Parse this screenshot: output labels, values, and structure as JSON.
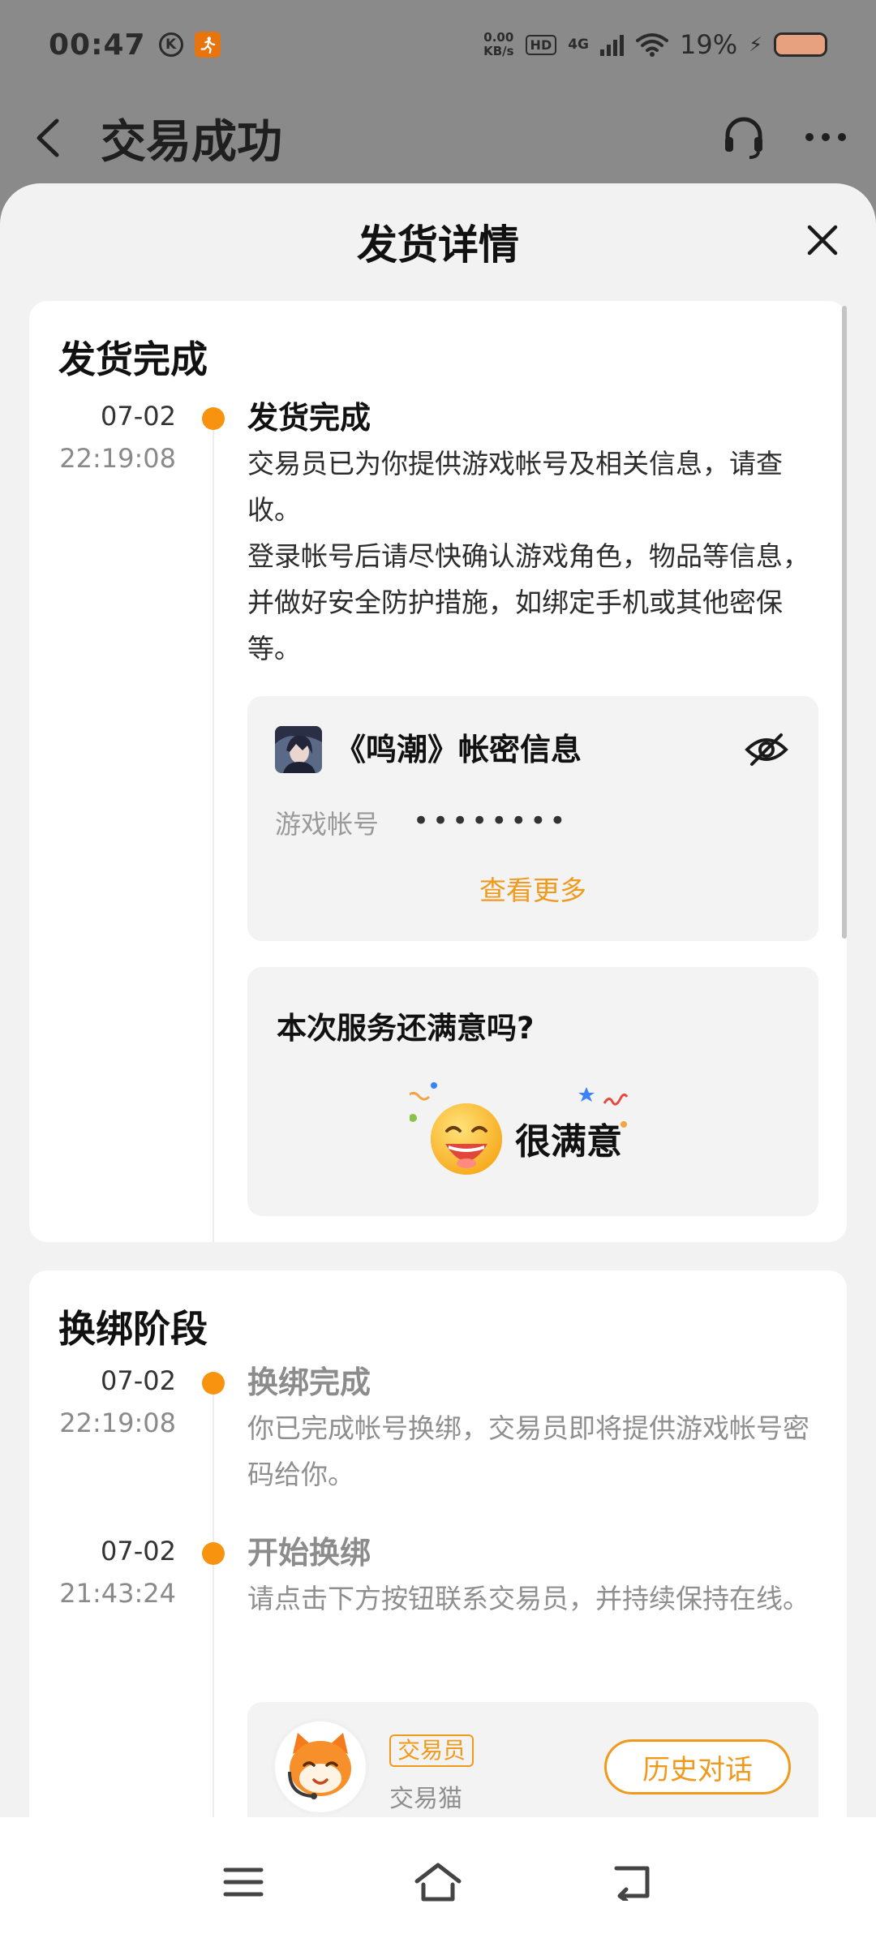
{
  "status_bar": {
    "time": "00:47",
    "k_icon": "K",
    "net_speed_value": "0.00",
    "net_speed_unit": "KB/s",
    "hd": "HD",
    "signal": "4G",
    "battery_percent": "19%",
    "battery_level": 0.19
  },
  "header": {
    "title": "交易成功"
  },
  "sheet": {
    "title": "发货详情"
  },
  "delivery_section": {
    "title": "发货完成",
    "event": {
      "date": "07-02",
      "time": "22:19:08",
      "heading": "发货完成",
      "body": "交易员已为你提供游戏帐号及相关信息，请查收。\n登录帐号后请尽快确认游戏角色，物品等信息，并做好安全防护措施，如绑定手机或其他密保等。"
    },
    "account_card": {
      "title": "《鸣潮》帐密信息",
      "field_label": "游戏帐号",
      "field_value": "••••••••",
      "more_link": "查看更多"
    },
    "rating_card": {
      "question": "本次服务还满意吗?",
      "rating_label": "很满意"
    }
  },
  "rebind_section": {
    "title": "换绑阶段",
    "events": [
      {
        "date": "07-02",
        "time": "22:19:08",
        "heading": "换绑完成",
        "body": "你已完成帐号换绑，交易员即将提供游戏帐号密码给你。"
      },
      {
        "date": "07-02",
        "time": "21:43:24",
        "heading": "开始换绑",
        "body": "请点击下方按钮联系交易员，并持续保持在线。"
      }
    ],
    "agent": {
      "badge": "交易员",
      "name": "交易猫",
      "history_button": "历史对话"
    }
  },
  "colors": {
    "accent": "#f7930f",
    "link": "#f09a1d",
    "sheet_bg": "#f2f2f2",
    "card_bg": "#ffffff"
  },
  "icons": {
    "back": "chevron-left-icon",
    "support": "headset-icon",
    "more": "more-horizontal-icon",
    "close": "close-icon",
    "hide": "eye-off-icon",
    "menu": "menu-icon",
    "home": "home-icon",
    "back_nav": "back-icon"
  }
}
